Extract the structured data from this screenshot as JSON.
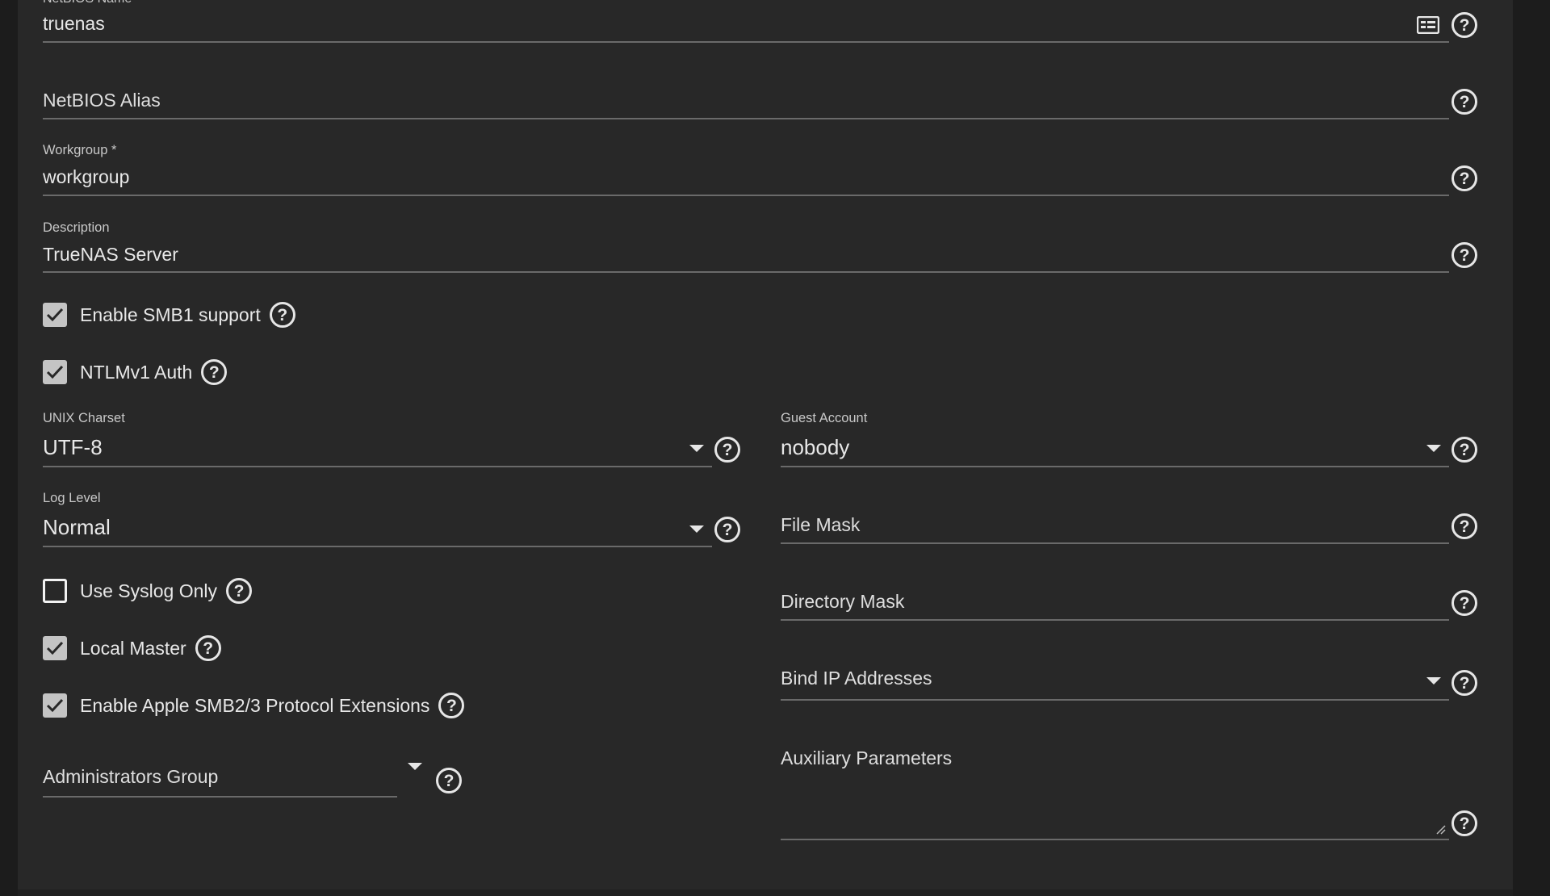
{
  "netbios_name": {
    "label": "NetBIOS Name",
    "value": "truenas"
  },
  "netbios_alias": {
    "placeholder": "NetBIOS Alias"
  },
  "workgroup": {
    "label": "Workgroup *",
    "value": "workgroup"
  },
  "description": {
    "label": "Description",
    "value": "TrueNAS Server"
  },
  "enable_smb1": {
    "label": "Enable SMB1 support",
    "checked": true
  },
  "ntlmv1_auth": {
    "label": "NTLMv1 Auth",
    "checked": true
  },
  "unix_charset": {
    "label": "UNIX Charset",
    "value": "UTF-8"
  },
  "guest_account": {
    "label": "Guest Account",
    "value": "nobody"
  },
  "log_level": {
    "label": "Log Level",
    "value": "Normal"
  },
  "file_mask": {
    "placeholder": "File Mask"
  },
  "use_syslog_only": {
    "label": "Use Syslog Only",
    "checked": false
  },
  "directory_mask": {
    "placeholder": "Directory Mask"
  },
  "local_master": {
    "label": "Local Master",
    "checked": true
  },
  "bind_ip_addresses": {
    "placeholder": "Bind IP Addresses"
  },
  "apple_smb_extensions": {
    "label": "Enable Apple SMB2/3 Protocol Extensions",
    "checked": true
  },
  "administrators_group": {
    "placeholder": "Administrators Group"
  },
  "auxiliary_parameters": {
    "placeholder": "Auxiliary Parameters",
    "value": ""
  },
  "help_glyph": "?",
  "icons": {
    "help": "help-circle-icon",
    "dropdown": "arrow-drop-down-icon",
    "check": "check-icon",
    "autofill": "contact-card-icon"
  },
  "colors": {
    "background": "#1c1c1c",
    "card": "#282828",
    "text": "#e6e6e6",
    "underline": "#6a6a6a",
    "checkbox_checked": "#c4c4c4"
  }
}
